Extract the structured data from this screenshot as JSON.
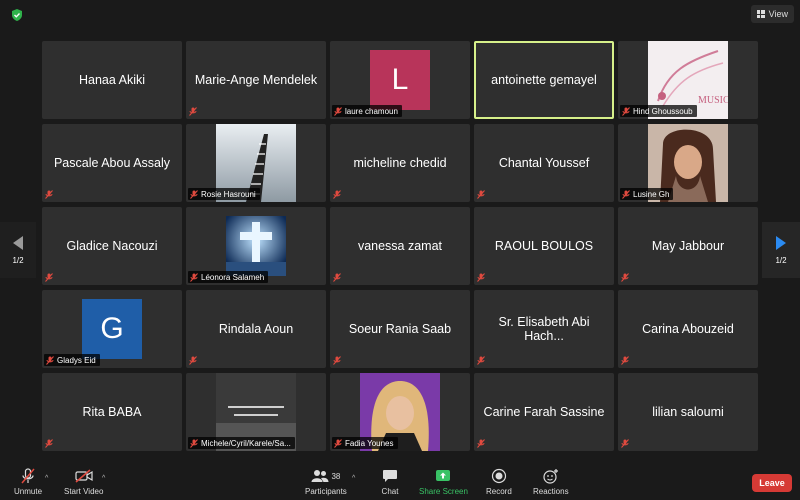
{
  "topbar": {
    "view_label": "View"
  },
  "pager": {
    "left": "1/2",
    "right": "1/2"
  },
  "tiles": [
    {
      "name": "Hanaa Akiki",
      "label": ""
    },
    {
      "name": "Marie-Ange Mendelek",
      "label": ""
    },
    {
      "name": "",
      "label": "laure chamoun",
      "avatar_letter": "L"
    },
    {
      "name": "antoinette gemayel",
      "label": ""
    },
    {
      "name": "",
      "label": "Hind Ghoussoub"
    },
    {
      "name": "Pascale Abou Assaly",
      "label": ""
    },
    {
      "name": "",
      "label": "Rosie Hasrouni"
    },
    {
      "name": "micheline chedid",
      "label": ""
    },
    {
      "name": "Chantal Youssef",
      "label": ""
    },
    {
      "name": "",
      "label": "Lusine Gh"
    },
    {
      "name": "Gladice Nacouzi",
      "label": ""
    },
    {
      "name": "",
      "label": "Léonora Salameh"
    },
    {
      "name": "vanessa zamat",
      "label": ""
    },
    {
      "name": "RAOUL BOULOS",
      "label": ""
    },
    {
      "name": "May Jabbour",
      "label": ""
    },
    {
      "name": "",
      "label": "Gladys Eid",
      "avatar_letter": "G"
    },
    {
      "name": "Rindala Aoun",
      "label": ""
    },
    {
      "name": "Soeur Rania Saab",
      "label": ""
    },
    {
      "name": "Sr. Elisabeth Abi Hach...",
      "label": ""
    },
    {
      "name": "Carina Abouzeid",
      "label": ""
    },
    {
      "name": "Rita BABA",
      "label": ""
    },
    {
      "name": "",
      "label": "Michele/Cyril/Karele/Sa..."
    },
    {
      "name": "",
      "label": "Fadia Younes"
    },
    {
      "name": "Carine Farah Sassine",
      "label": ""
    },
    {
      "name": "lilian saloumi",
      "label": ""
    }
  ],
  "toolbar": {
    "unmute": "Unmute",
    "start_video": "Start Video",
    "participants": "Participants",
    "participants_count": "38",
    "chat": "Chat",
    "share_screen": "Share Screen",
    "record": "Record",
    "reactions": "Reactions",
    "leave": "Leave"
  },
  "colors": {
    "tile_bg": "#2f2f2f",
    "active_speaker": "#d6f08a",
    "leave": "#d63a35",
    "share": "#39c265",
    "avatar_l": "#b8345a",
    "avatar_g": "#1f5ea8"
  },
  "icons": [
    "shield-icon",
    "grid-icon",
    "mic-muted-icon",
    "video-off-icon",
    "participants-icon",
    "chat-icon",
    "share-screen-icon",
    "record-icon",
    "reactions-icon"
  ]
}
